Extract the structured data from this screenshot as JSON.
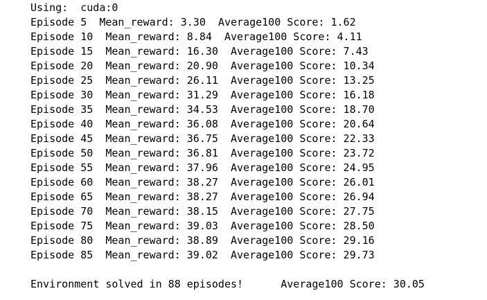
{
  "output": {
    "lines": [
      "Using:  cuda:0",
      "Episode 5  Mean_reward: 3.30  Average100 Score: 1.62",
      "Episode 10  Mean_reward: 8.84  Average100 Score: 4.11",
      "Episode 15  Mean_reward: 16.30  Average100 Score: 7.43",
      "Episode 20  Mean_reward: 20.90  Average100 Score: 10.34",
      "Episode 25  Mean_reward: 26.11  Average100 Score: 13.25",
      "Episode 30  Mean_reward: 31.29  Average100 Score: 16.18",
      "Episode 35  Mean_reward: 34.53  Average100 Score: 18.70",
      "Episode 40  Mean_reward: 36.08  Average100 Score: 20.64",
      "Episode 45  Mean_reward: 36.75  Average100 Score: 22.33",
      "Episode 50  Mean_reward: 36.81  Average100 Score: 23.72",
      "Episode 55  Mean_reward: 37.96  Average100 Score: 24.95",
      "Episode 60  Mean_reward: 38.27  Average100 Score: 26.01",
      "Episode 65  Mean_reward: 38.27  Average100 Score: 26.94",
      "Episode 70  Mean_reward: 38.15  Average100 Score: 27.75",
      "Episode 75  Mean_reward: 39.03  Average100 Score: 28.50",
      "Episode 80  Mean_reward: 38.89  Average100 Score: 29.16",
      "Episode 85  Mean_reward: 39.02  Average100 Score: 29.73",
      "",
      "Environment solved in 88 episodes!      Average100 Score: 30.05"
    ]
  }
}
